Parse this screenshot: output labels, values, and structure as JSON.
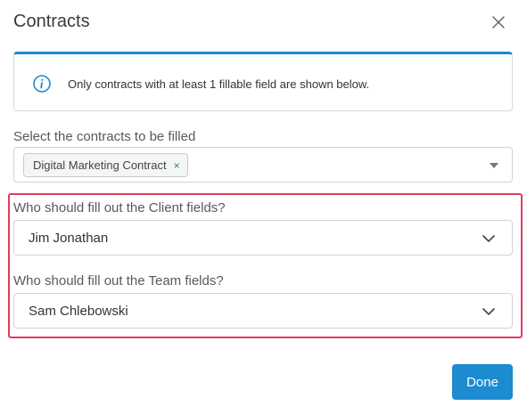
{
  "dialog": {
    "title": "Contracts",
    "close_icon": "close-icon"
  },
  "info": {
    "icon": "info-icon",
    "text": "Only contracts with at least 1 fillable field are shown below."
  },
  "contracts": {
    "label": "Select the contracts to be filled",
    "selected": [
      {
        "label": "Digital Marketing Contract",
        "remove": "×"
      }
    ]
  },
  "client": {
    "label": "Who should fill out the Client fields?",
    "value": "Jim Jonathan"
  },
  "team": {
    "label": "Who should fill out the Team fields?",
    "value": "Sam Chlebowski"
  },
  "actions": {
    "done_label": "Done"
  },
  "colors": {
    "accent": "#1c8bd0",
    "highlight": "#e23a5f"
  }
}
